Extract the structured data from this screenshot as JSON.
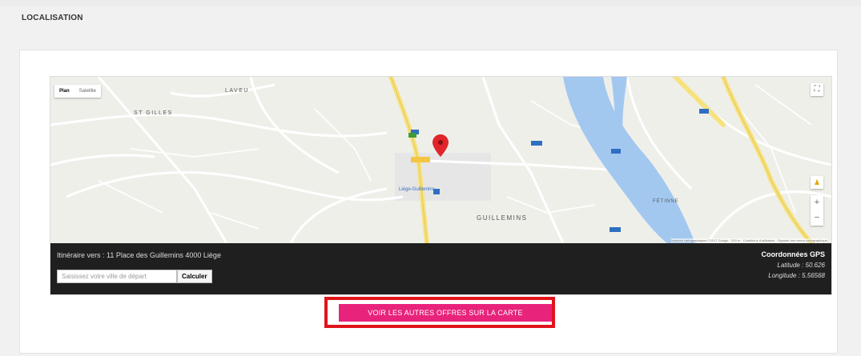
{
  "section": {
    "title": "LOCALISATION"
  },
  "map": {
    "map_type_options": [
      "Plan",
      "Satellite"
    ],
    "places": [
      "LAVEU",
      "ST GILLES",
      "GUILLEMINS",
      "FÉTINNE"
    ],
    "station_label": "Liège-Guillemins",
    "footer": "Données cartographiques ©2017 Google · 200 m · Conditions d'utilisation · Signaler une erreur cartographique",
    "colors": {
      "river": "#a3c8f0",
      "major_road": "#f6e27f",
      "pin": "#e0262b"
    }
  },
  "route": {
    "itinerary_text": "Itinéraire vers : 11 Place des Guillemins 4000 Liège",
    "input_placeholder": "Saisissez votre ville de départ",
    "button_label": "Calculer"
  },
  "gps": {
    "title": "Coordonnées GPS",
    "latitude": "Latitude : 50.626",
    "longitude": "Longitude : 5.56568"
  },
  "cta": {
    "label": "VOIR LES AUTRES OFFRES SUR LA CARTE",
    "color": "#e8237b",
    "highlight_color": "#e0141c"
  }
}
